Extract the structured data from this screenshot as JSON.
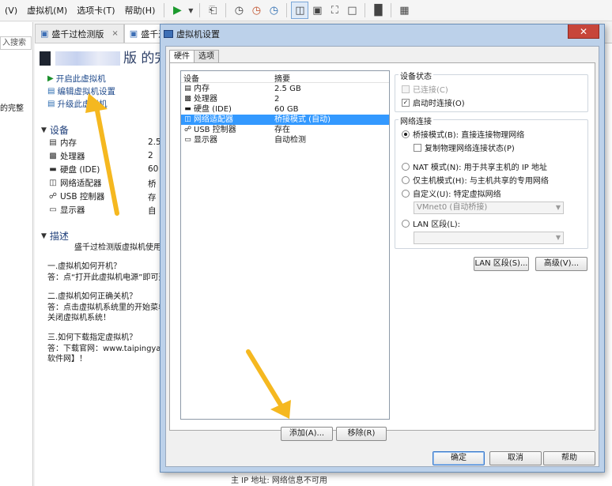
{
  "menubar": {
    "items": [
      "虚拟机(M)",
      "选项卡(T)",
      "帮助(H)"
    ],
    "leading_fragment": "(V)",
    "icons": [
      "play-icon",
      "dropdown-icon",
      "suspend-icon",
      "snapshot-icon",
      "revert-snapshot-icon",
      "snapshot-manager-icon",
      "view-console-icon",
      "view-fullscreen-minimal-icon",
      "fit-guest-icon",
      "fullscreen-icon",
      "terminal-icon",
      "unity-icon"
    ]
  },
  "library": {
    "search_placeholder": "入搜索",
    "item_fragment": "的完整"
  },
  "tabs": [
    {
      "label": "盛千过检测版",
      "close": "×"
    },
    {
      "label": "盛千过检"
    }
  ],
  "vm": {
    "title_suffix": "版 的完",
    "actions": [
      "开启此虚拟机",
      "编辑虚拟机设置",
      "升级此虚拟机"
    ],
    "devices_header": "设备",
    "devices": [
      {
        "name": "内存",
        "value": "2.5"
      },
      {
        "name": "处理器",
        "value": "2"
      },
      {
        "name": "硬盘 (IDE)",
        "value": "60"
      },
      {
        "name": "网络适配器",
        "value": "桥"
      },
      {
        "name": "USB 控制器",
        "value": "存"
      },
      {
        "name": "显示器",
        "value": "自"
      }
    ],
    "desc_header": "描述",
    "description_lines": [
      "盛千过检测版虚拟机使用必",
      "一.虚拟机如何开机？",
      "答：点“打开此虚拟机电源”即可开",
      "二.虚拟机如何正确关机？",
      "答：点击虚拟机系统里的开始菜单“关",
      "关闭虚拟机系统！",
      "三.如何下载指定虚拟机？",
      "答：下载官网：www.taipingyangn",
      "软件网】！"
    ]
  },
  "dialog": {
    "title": "虚拟机设置",
    "close": "✕",
    "tabs": [
      "硬件",
      "选项"
    ],
    "device_list": {
      "headers": [
        "设备",
        "摘要"
      ],
      "rows": [
        {
          "icon": "memory-icon",
          "name": "内存",
          "summary": "2.5 GB",
          "selected": false
        },
        {
          "icon": "cpu-icon",
          "name": "处理器",
          "summary": "2",
          "selected": false
        },
        {
          "icon": "disk-icon",
          "name": "硬盘 (IDE)",
          "summary": "60 GB",
          "selected": false
        },
        {
          "icon": "network-icon",
          "name": "网络适配器",
          "summary": "桥接模式 (自动)",
          "selected": true
        },
        {
          "icon": "usb-icon",
          "name": "USB 控制器",
          "summary": "存在",
          "selected": false
        },
        {
          "icon": "monitor-icon",
          "name": "显示器",
          "summary": "自动检测",
          "selected": false
        }
      ]
    },
    "device_status": {
      "label": "设备状态",
      "connected": "已连接(C)",
      "connect_at_power_on": "启动时连接(O)"
    },
    "network_connection": {
      "label": "网络连接",
      "bridged": "桥接模式(B): 直接连接物理网络",
      "replicate": "复制物理网络连接状态(P)",
      "nat": "NAT 模式(N): 用于共享主机的 IP 地址",
      "host_only": "仅主机模式(H): 与主机共享的专用网络",
      "custom": "自定义(U): 特定虚拟网络",
      "custom_value": "VMnet0 (自动桥接)",
      "lan": "LAN 区段(L):",
      "lan_value": ""
    },
    "buttons": {
      "lan_segments": "LAN 区段(S)...",
      "advanced": "高级(V)...",
      "add": "添加(A)...",
      "remove": "移除(R)",
      "ok": "确定",
      "cancel": "取消",
      "help": "帮助"
    }
  },
  "status_text": "主 IP 地址: 网络信息不可用",
  "colors": {
    "selection": "#3399ff",
    "arrow": "#f5b820",
    "link": "#1f4a8c",
    "close": "#c7453a"
  }
}
